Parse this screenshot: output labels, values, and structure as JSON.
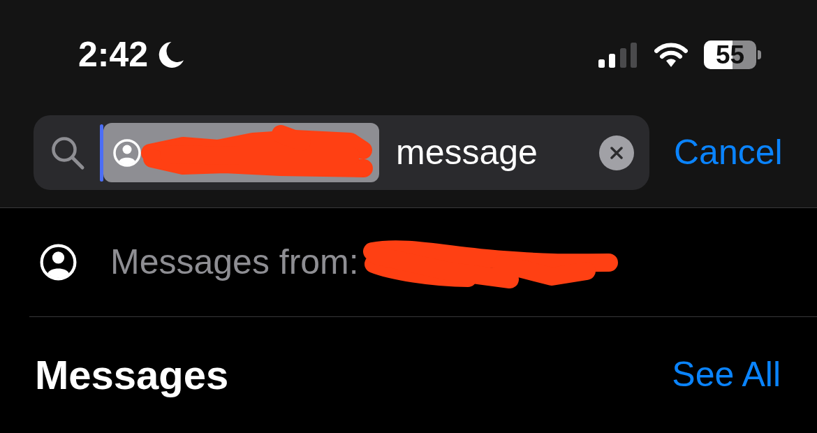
{
  "status_bar": {
    "time": "2:42",
    "focus_on": true,
    "battery_text": "55"
  },
  "search": {
    "focused": true,
    "token": {
      "redacted": true
    },
    "value": "message",
    "cancel": "Cancel"
  },
  "suggestions": [
    {
      "label": "Messages from:",
      "redacted": true
    }
  ],
  "section": {
    "title": "Messages",
    "action": "See All"
  }
}
